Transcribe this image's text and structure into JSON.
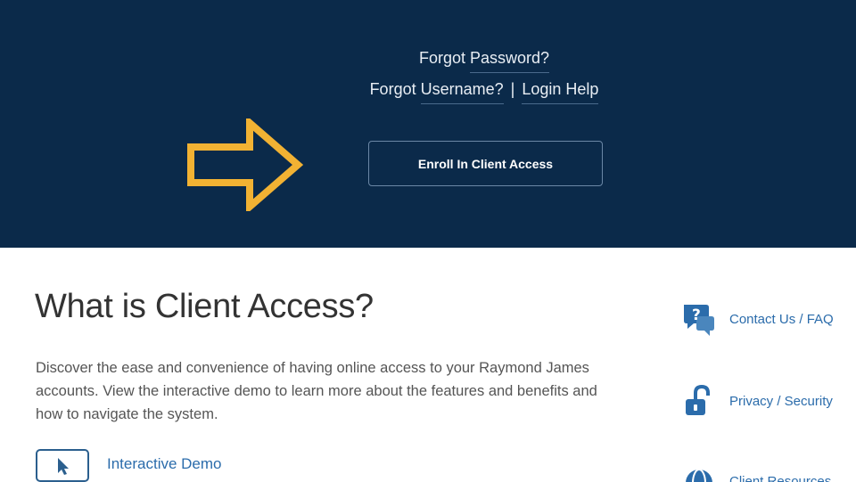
{
  "hero": {
    "forgot_label_1": "Forgot",
    "forgot_password": "Password?",
    "forgot_label_2": "Forgot",
    "forgot_username": "Username?",
    "separator": "|",
    "login_help": "Login Help",
    "enroll_button": "Enroll In Client Access",
    "arrow_color": "#f2b233",
    "background": "#0b2a4a"
  },
  "main": {
    "title": "What is Client Access?",
    "description": "Discover the ease and convenience of having online access to your Raymond James accounts. View the interactive demo to learn more about the features and benefits and how to navigate the system.",
    "demo_link": "Interactive Demo"
  },
  "sidebar": {
    "items": [
      {
        "label": "Contact Us / FAQ",
        "icon": "chat-question-icon"
      },
      {
        "label": "Privacy / Security",
        "icon": "padlock-icon"
      },
      {
        "label": "Client Resources",
        "icon": "globe-icon"
      }
    ]
  }
}
